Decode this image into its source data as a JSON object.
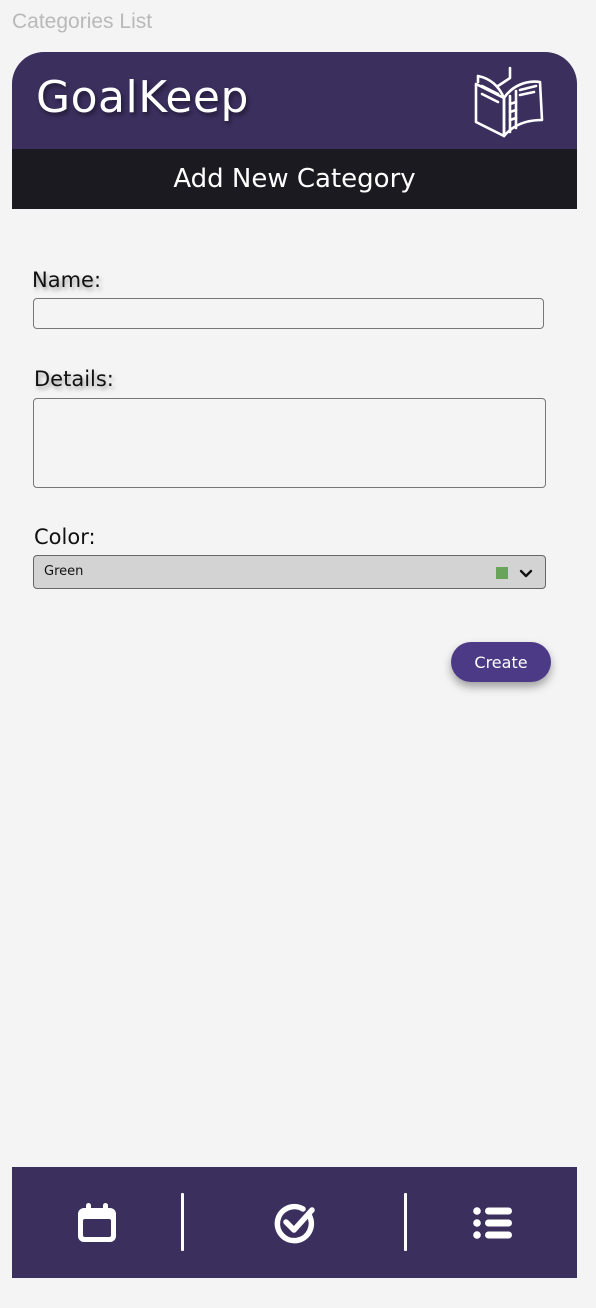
{
  "page": {
    "label": "Categories List"
  },
  "header": {
    "app_title": "GoalKeep",
    "book_icon": "open-book-icon"
  },
  "subheader": {
    "title": "Add New Category"
  },
  "form": {
    "name_label": "Name:",
    "name_value": "",
    "details_label": "Details:",
    "details_value": "",
    "color_label": "Color:",
    "color_selected": "Green",
    "color_swatch": "#6aa35a",
    "create_label": "Create"
  },
  "nav": {
    "items": [
      {
        "icon": "calendar-icon"
      },
      {
        "icon": "check-circle-icon"
      },
      {
        "icon": "list-icon"
      }
    ]
  },
  "colors": {
    "primary": "#3b2f5e",
    "subheader": "#1c1a21",
    "button": "#4d3a87",
    "background": "#f4f4f4"
  }
}
